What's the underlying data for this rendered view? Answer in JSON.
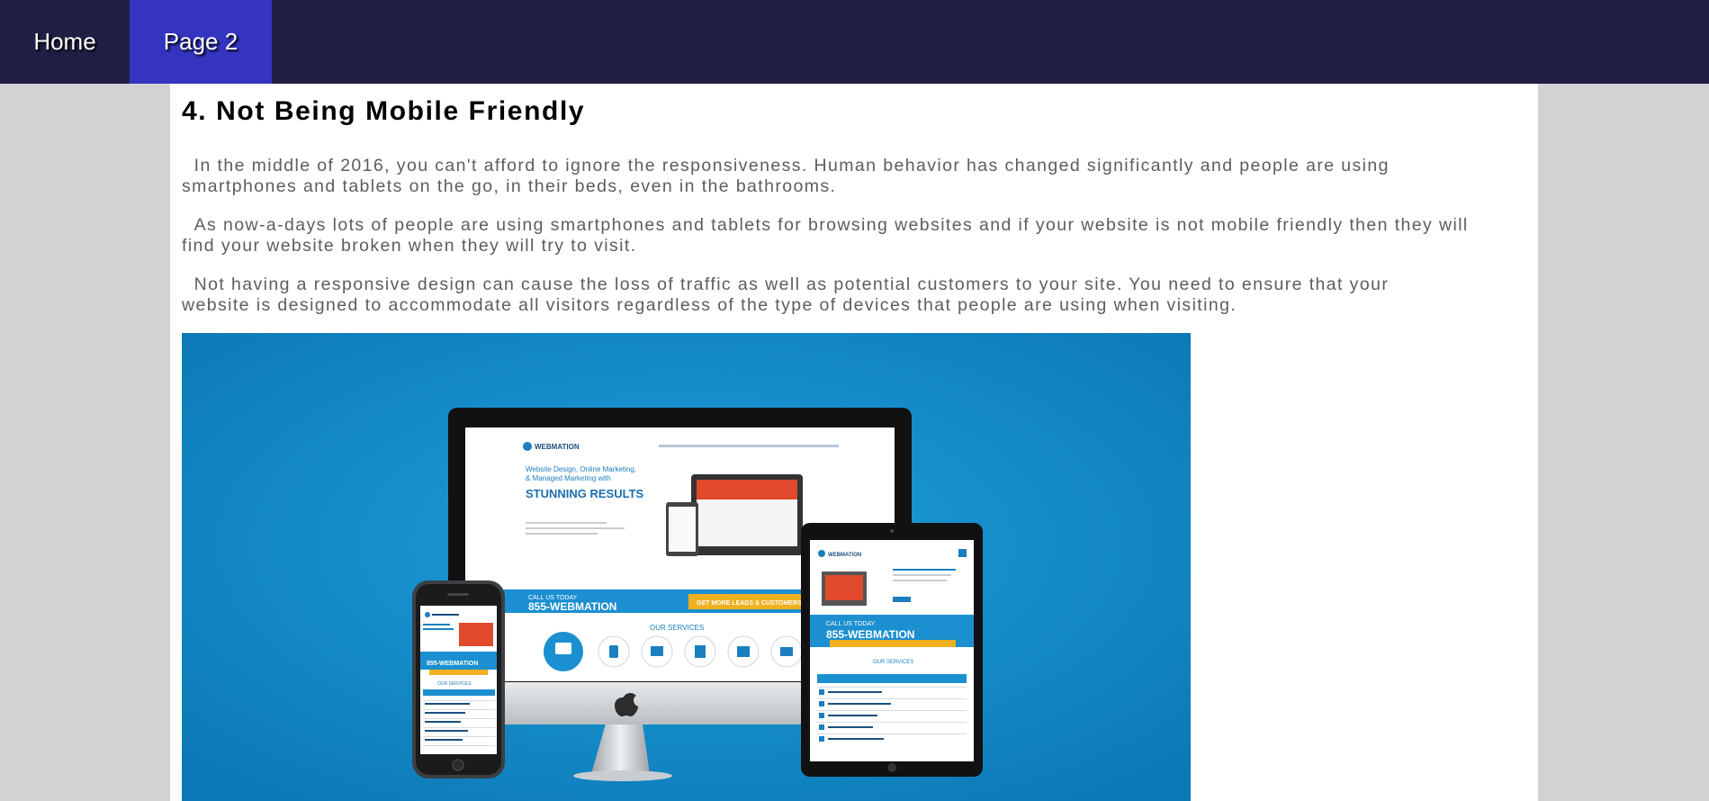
{
  "nav": {
    "items": [
      {
        "label": "Home"
      },
      {
        "label": "Page 2"
      }
    ]
  },
  "article": {
    "heading": "4. Not Being Mobile Friendly",
    "paragraphs": [
      "  In the middle of 2016, you can't afford to ignore the responsiveness. Human behavior has changed significantly and people are using smartphones and tablets on the go, in their beds, even in the bathrooms.",
      "  As now-a-days lots of people are using smartphones and tablets for browsing websites and if your website is not mobile friendly then they will find your website broken when they will try to visit.",
      "  Not having a responsive design can cause the loss of traffic as well as potential customers to your site. You need to ensure that your website is designed to accommodate all visitors regardless of the type of devices that people are using when visiting."
    ]
  },
  "image": {
    "brand": "WEBMATION",
    "headline_line1": "Website Design, Online Marketing,",
    "headline_line2": "& Managed Marketing with",
    "headline_big": "STUNNING RESULTS",
    "call_small": "CALL US TODAY",
    "call_number": "855-WEBMATION",
    "cta": "GET MORE LEADS & CUSTOMERS",
    "services_title": "OUR SERVICES"
  },
  "colors": {
    "navbar": "#1f1f44",
    "nav_active": "#3434c0",
    "page_bg": "#d3d2d3",
    "image_bg": "#0f8ac9"
  }
}
